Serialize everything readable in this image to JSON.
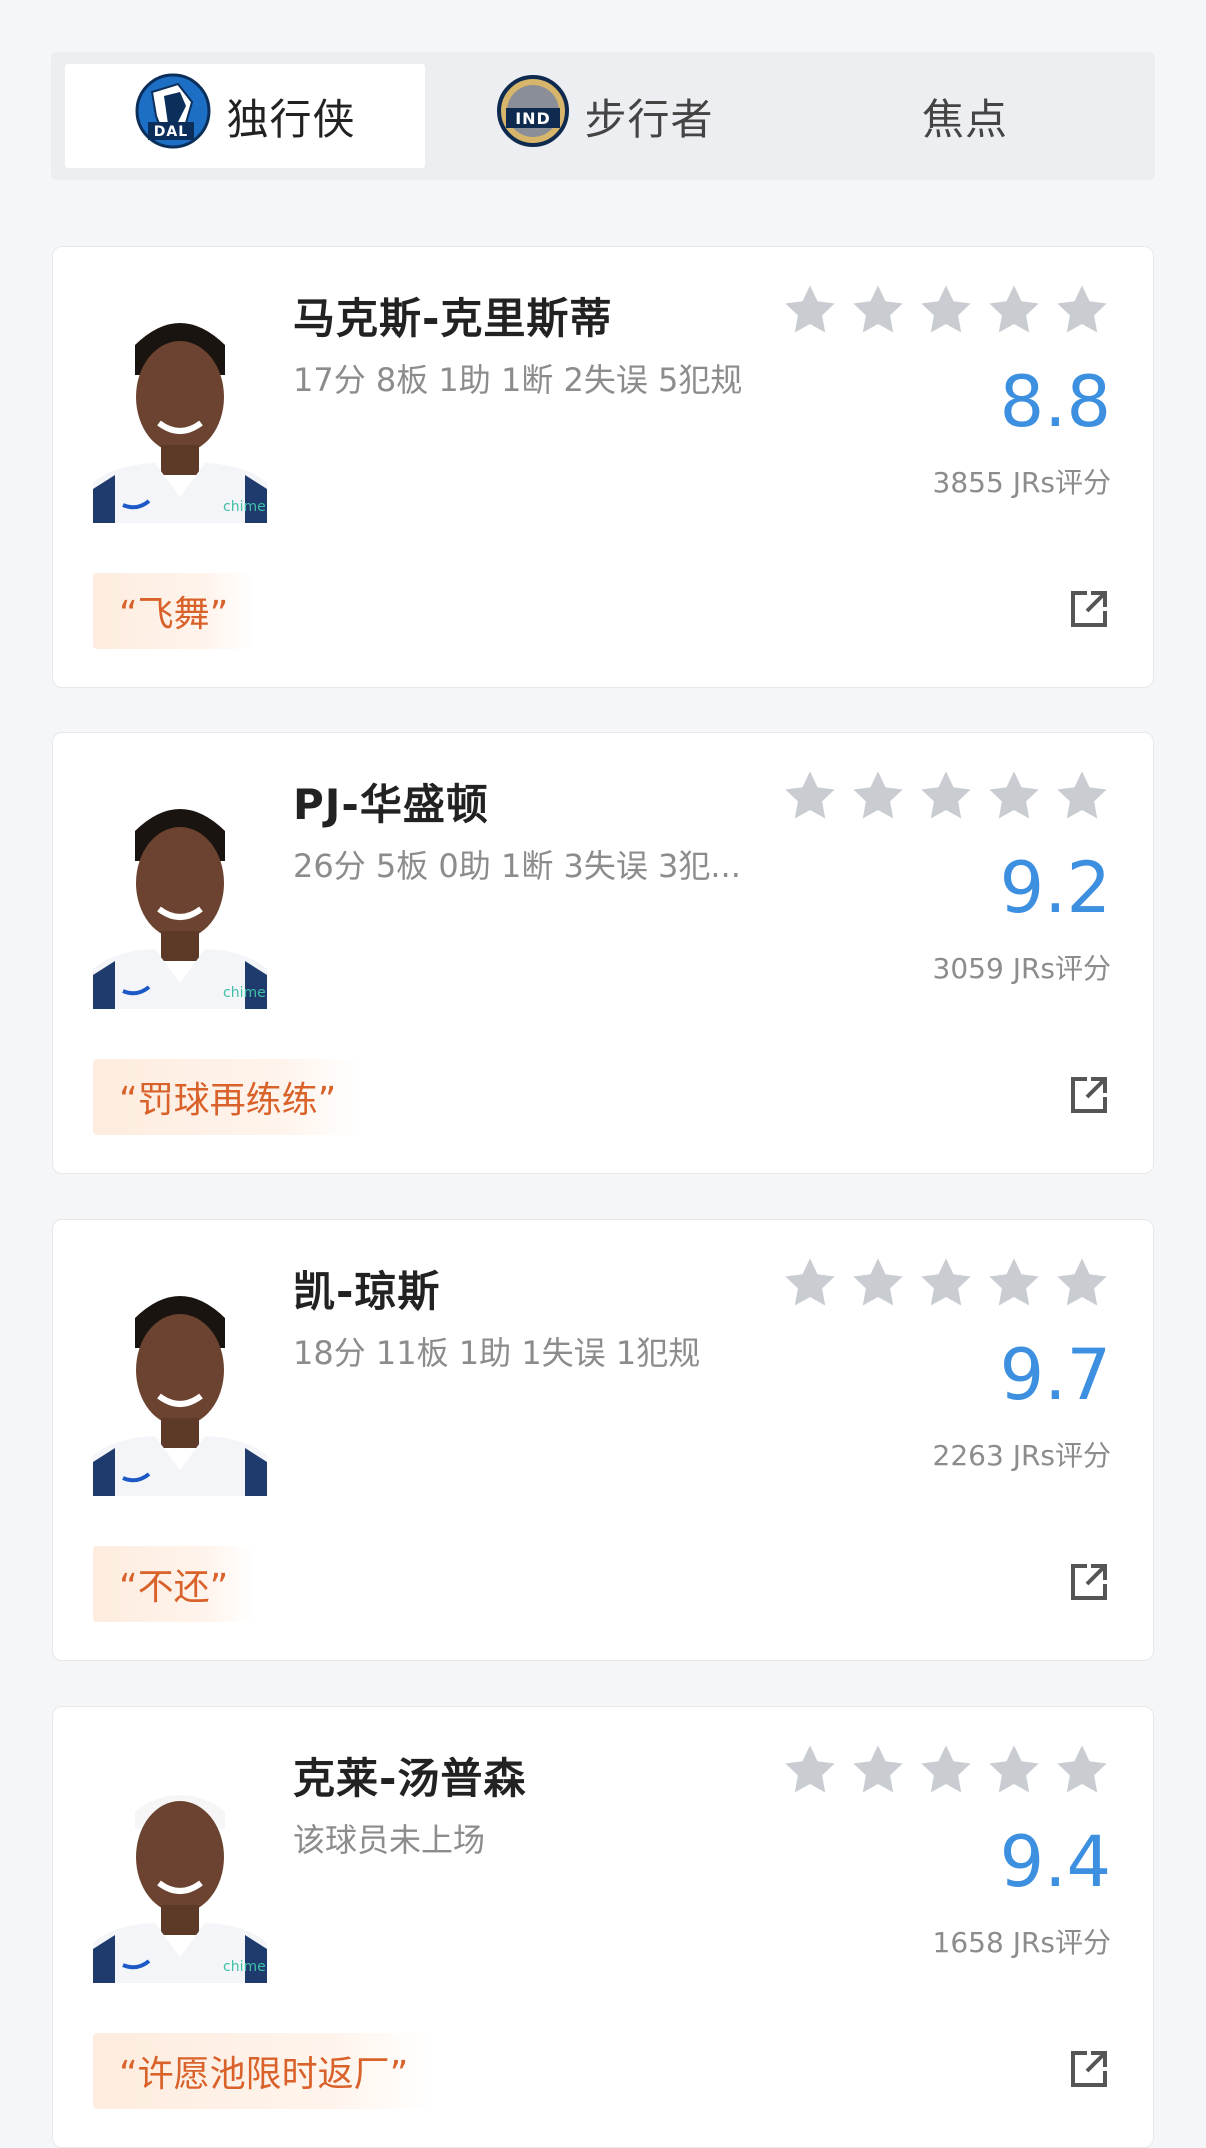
{
  "tabs": [
    {
      "label": "独行侠",
      "logo_text": "DAL",
      "active": true
    },
    {
      "label": "步行者",
      "logo_text": "IND",
      "active": false
    },
    {
      "label": "焦点",
      "active": false
    }
  ],
  "players": [
    {
      "name": "马克斯-克里斯蒂",
      "stats": "17分 8板 1助 1断 2失误 5犯规",
      "score": "8.8",
      "votes": "3855 JRs评分",
      "quote": "“飞舞”",
      "jersey_text": "chime"
    },
    {
      "name": "PJ-华盛顿",
      "stats": "26分 5板 0助 1断 3失误 3犯...",
      "score": "9.2",
      "votes": "3059 JRs评分",
      "quote": "“罚球再练练”",
      "jersey_text": "chime"
    },
    {
      "name": "凯-琼斯",
      "stats": "18分 11板 1助 1失误 1犯规",
      "score": "9.7",
      "votes": "2263 JRs评分",
      "quote": "“不还”",
      "jersey_text": ""
    },
    {
      "name": "克莱-汤普森",
      "stats": "该球员未上场",
      "score": "9.4",
      "votes": "1658 JRs评分",
      "quote": "“许愿池限时返厂”",
      "jersey_text": "chime"
    }
  ],
  "colors": {
    "score": "#3d8fe0",
    "quote": "#d9622b",
    "star": "#c9ccd1"
  }
}
